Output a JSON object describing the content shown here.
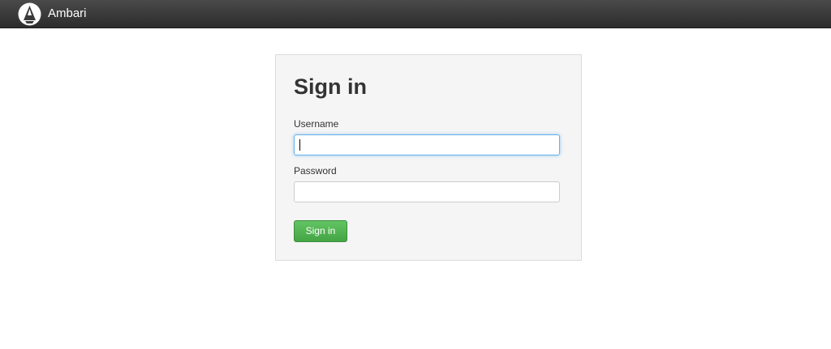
{
  "header": {
    "brand": "Ambari",
    "logo_icon": "ambari-logo-icon"
  },
  "login": {
    "title": "Sign in",
    "username_label": "Username",
    "username_value": "",
    "password_label": "Password",
    "password_value": "",
    "submit_label": "Sign in"
  },
  "colors": {
    "navbar": "#333333",
    "panel": "#f5f5f5",
    "button": "#51b351",
    "focus": "#66afe9"
  }
}
